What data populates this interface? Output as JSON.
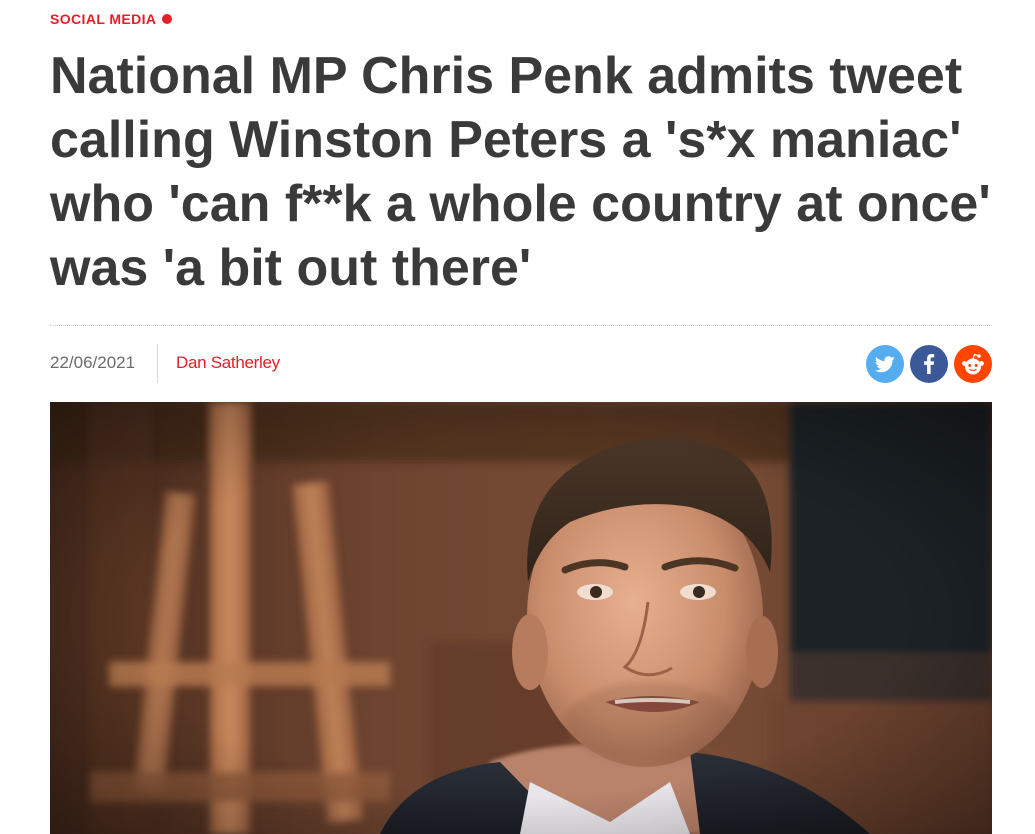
{
  "category": {
    "label": "SOCIAL MEDIA",
    "color": "#e2202a"
  },
  "headline": "National MP Chris Penk admits tweet calling Winston Peters a 's*x maniac' who 'can f**k a whole country at once' was 'a bit out there'",
  "meta": {
    "date": "22/06/2021",
    "author": "Dan Satherley",
    "author_color": "#e2202a"
  },
  "share": {
    "twitter": {
      "icon": "twitter-icon",
      "color": "#55acee"
    },
    "facebook": {
      "icon": "facebook-icon",
      "color": "#3b5998"
    },
    "reddit": {
      "icon": "reddit-icon",
      "color": "#ff4500"
    }
  },
  "hero_image": {
    "description_icon": "man-portrait-photo"
  }
}
